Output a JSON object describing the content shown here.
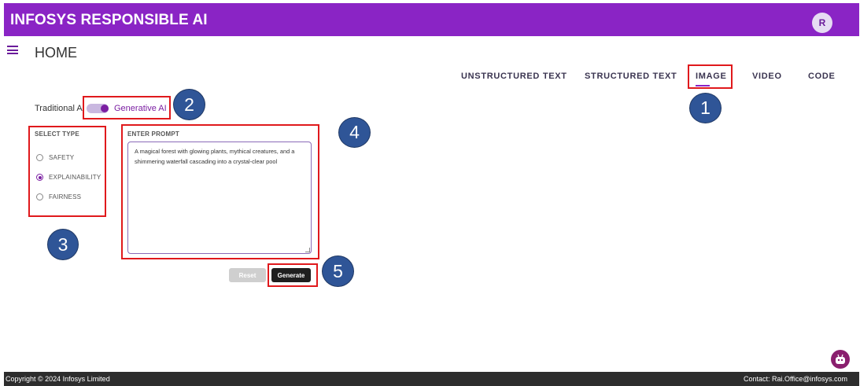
{
  "header": {
    "title": "INFOSYS RESPONSIBLE AI",
    "avatar_initial": "R",
    "brand_color": "#8a24c5"
  },
  "page": {
    "title": "HOME"
  },
  "tabs": [
    {
      "label": "UNSTRUCTURED TEXT",
      "selected": false
    },
    {
      "label": "STRUCTURED TEXT",
      "selected": false
    },
    {
      "label": "IMAGE",
      "selected": true
    },
    {
      "label": "VIDEO",
      "selected": false
    },
    {
      "label": "CODE",
      "selected": false
    }
  ],
  "ai_toggle": {
    "left_label": "Traditional AI",
    "right_label": "Generative AI",
    "state": "Generative AI"
  },
  "select_type": {
    "label": "SELECT TYPE",
    "options": [
      "SAFETY",
      "EXPLAINABILITY",
      "FAIRNESS"
    ],
    "selected": "EXPLAINABILITY"
  },
  "prompt": {
    "label": "ENTER PROMPT",
    "value": "A magical forest with glowing plants, mythical creatures, and a shimmering waterfall cascading into a crystal-clear pool"
  },
  "buttons": {
    "reset": "Reset",
    "generate": "Generate"
  },
  "annotations": [
    "1",
    "2",
    "3",
    "4",
    "5"
  ],
  "footer": {
    "copyright": "Copyright © 2024 Infosys Limited",
    "contact": "Contact: Rai.Office@infosys.com"
  },
  "chat": {
    "icon": "robot-icon"
  }
}
